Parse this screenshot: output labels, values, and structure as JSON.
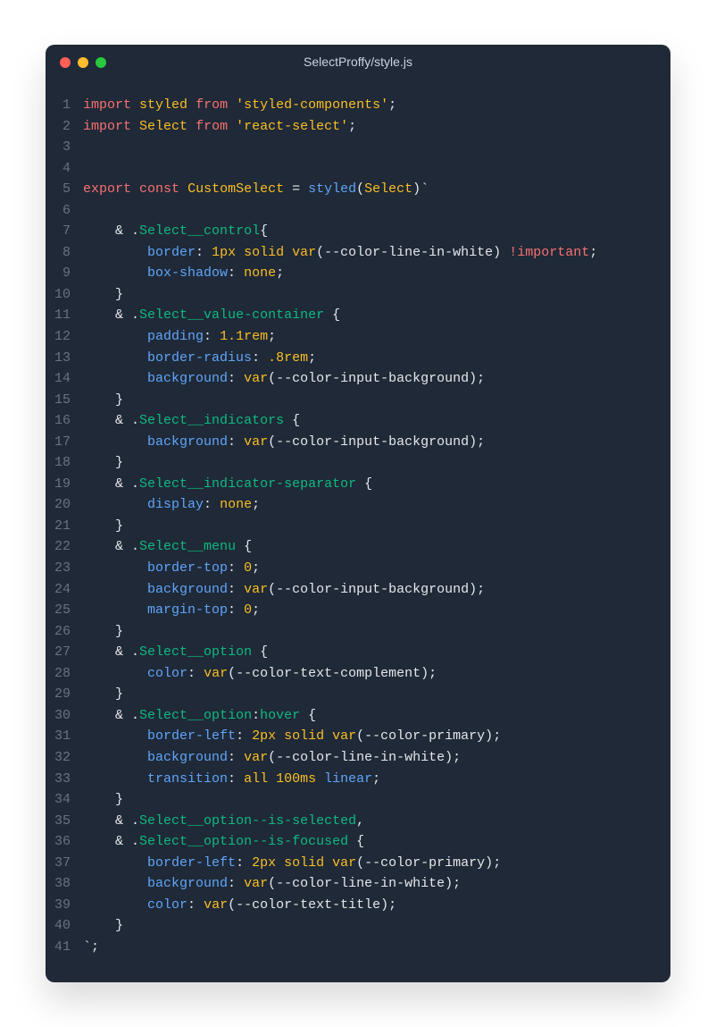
{
  "window": {
    "title": "SelectProffy/style.js"
  },
  "gutter": " 1\n 2\n 3\n 4\n 5\n 6\n 7\n 8\n 9\n10\n11\n12\n13\n14\n15\n16\n17\n18\n19\n20\n21\n22\n23\n24\n25\n26\n27\n28\n29\n30\n31\n32\n33\n34\n35\n36\n37\n38\n39\n40\n41",
  "t": {
    "import": "import",
    "styled_id": "styled",
    "from": "from",
    "str_sc": "'styled-components'",
    "select_id": "Select",
    "str_rs": "'react-select'",
    "export": "export",
    "const": "const",
    "custom": "CustomSelect",
    "eq": " = ",
    "styled_fn": "styled",
    "lparen": "(",
    "rparen": ")",
    "backtick": "`",
    "semi": ";",
    "amp": "    & ",
    "dot": ".",
    "cls_control": "Select__control",
    "cls_valcont": "Select__value-container",
    "cls_indicators": "Select__indicators",
    "cls_indsep": "Select__indicator-separator",
    "cls_menu": "Select__menu",
    "cls_option": "Select__option",
    "cls_opt_selected": "Select__option--is-selected",
    "cls_opt_focused": "Select__option--is-focused",
    "hover": "hover",
    "lbrace": "{",
    "rbrace": "}",
    "lbrace_sp": " {",
    "rbrace_ind": "    }",
    "colon_sp": ": ",
    "colon": ":",
    "comma": ",",
    "attr_border": "border",
    "attr_boxshadow": "box-shadow",
    "attr_padding": "padding",
    "attr_bradius": "border-radius",
    "attr_bg": "background",
    "attr_display": "display",
    "attr_btop": "border-top",
    "attr_mtop": "margin-top",
    "attr_color": "color",
    "attr_bleft": "border-left",
    "attr_transition": "transition",
    "val_1px": "1px",
    "val_2px": "2px",
    "val_solid": "solid",
    "val_none": "none",
    "val_11rem": "1.1rem",
    "val_8rem": ".8rem",
    "val_0": "0",
    "val_all": "all",
    "val_100ms": "100ms",
    "val_linear": "linear",
    "var_kw": "var",
    "var_line_white": "(--color-line-in-white)",
    "var_input_bg": "(--color-input-background)",
    "var_text_comp": "(--color-text-complement)",
    "var_primary": "(--color-primary)",
    "var_text_title": "(--color-text-title)",
    "important_sp": " !important",
    "important": "!important",
    "ind8": "        ",
    "end_backtick_semi": "`;"
  }
}
